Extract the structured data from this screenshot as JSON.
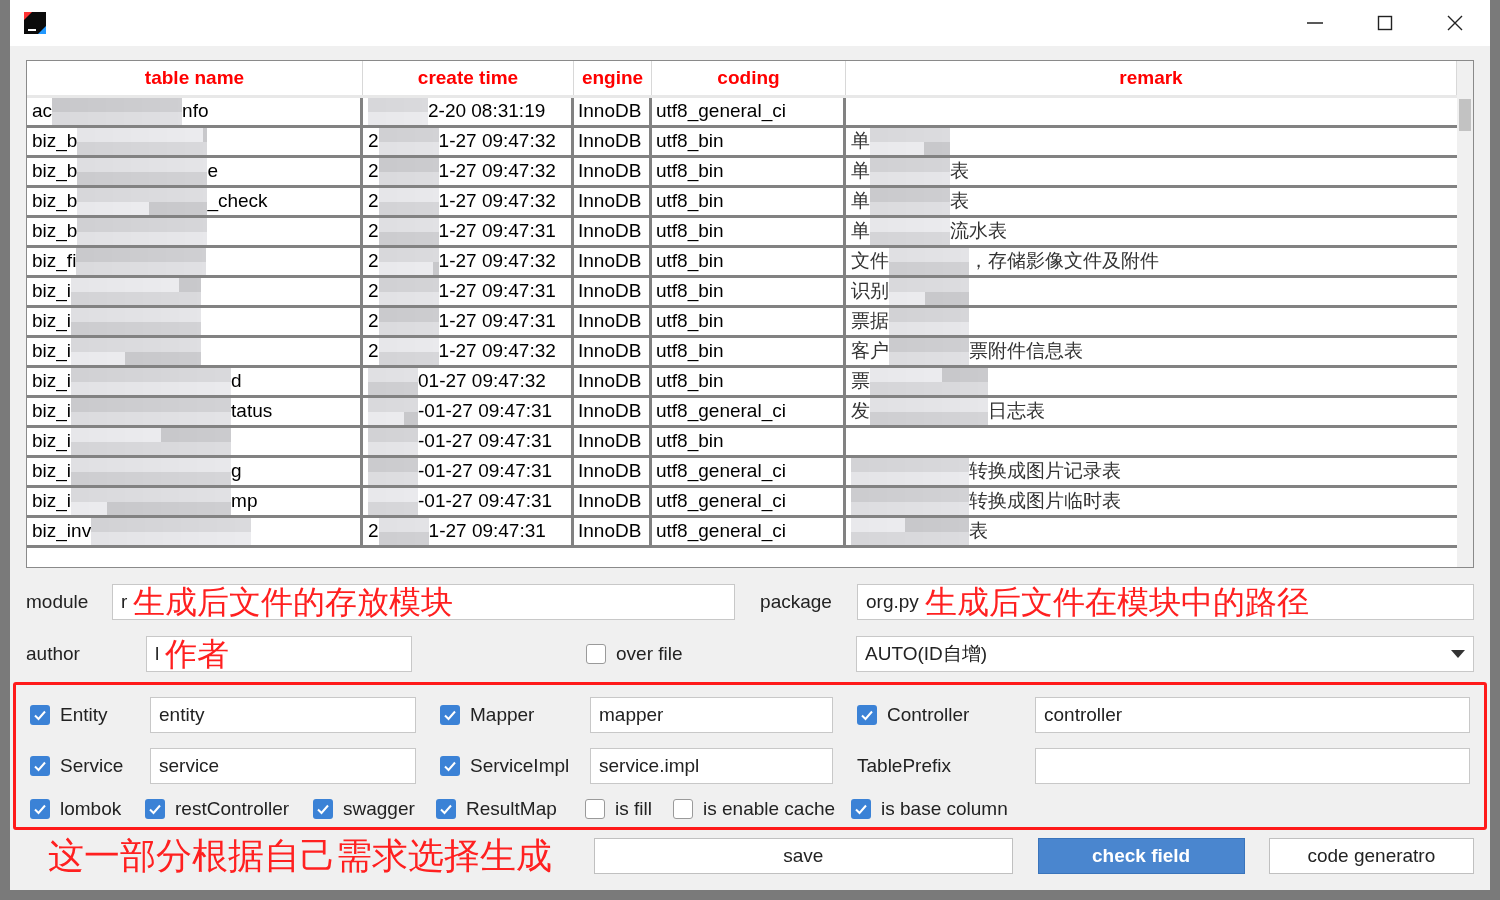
{
  "table": {
    "columns": [
      "table name",
      "create time",
      "engine",
      "coding",
      "remark"
    ],
    "rows": [
      {
        "name": {
          "start": "ac",
          "end": "nfo"
        },
        "time": {
          "end": "2-20 08:31:19"
        },
        "engine": "InnoDB",
        "coding": "utf8_general_ci",
        "remark": {}
      },
      {
        "name": {
          "start": "biz_b"
        },
        "time": {
          "start": "2",
          "end": "1-27 09:47:32"
        },
        "engine": "InnoDB",
        "coding": "utf8_bin",
        "remark": {
          "start": "单"
        }
      },
      {
        "name": {
          "start": "biz_b",
          "end": "e"
        },
        "time": {
          "start": "2",
          "end": "1-27 09:47:32"
        },
        "engine": "InnoDB",
        "coding": "utf8_bin",
        "remark": {
          "start": "单",
          "end": "表"
        }
      },
      {
        "name": {
          "start": "biz_b",
          "end": "_check"
        },
        "time": {
          "start": "2",
          "end": "1-27 09:47:32"
        },
        "engine": "InnoDB",
        "coding": "utf8_bin",
        "remark": {
          "start": "单",
          "end": "表"
        }
      },
      {
        "name": {
          "start": "biz_b"
        },
        "time": {
          "start": "2",
          "end": "1-27 09:47:31"
        },
        "engine": "InnoDB",
        "coding": "utf8_bin",
        "remark": {
          "start": "单",
          "end": "流水表"
        }
      },
      {
        "name": {
          "start": "biz_fi"
        },
        "time": {
          "start": "2",
          "end": "1-27 09:47:32"
        },
        "engine": "InnoDB",
        "coding": "utf8_bin",
        "remark": {
          "start": "文件",
          "end": "，存储影像文件及附件"
        }
      },
      {
        "name": {
          "start": "biz_i"
        },
        "time": {
          "start": "2",
          "end": "1-27 09:47:31"
        },
        "engine": "InnoDB",
        "coding": "utf8_bin",
        "remark": {
          "start": "识别"
        }
      },
      {
        "name": {
          "start": "biz_i"
        },
        "time": {
          "start": "2",
          "end": "1-27 09:47:31"
        },
        "engine": "InnoDB",
        "coding": "utf8_bin",
        "remark": {
          "start": "票据"
        }
      },
      {
        "name": {
          "start": "biz_i"
        },
        "time": {
          "start": "2",
          "end": "1-27 09:47:32"
        },
        "engine": "InnoDB",
        "coding": "utf8_bin",
        "remark": {
          "start": "客户",
          "end": "票附件信息表"
        }
      },
      {
        "name": {
          "start": "biz_i",
          "end": "d"
        },
        "time": {
          "end": "01-27 09:47:32"
        },
        "engine": "InnoDB",
        "coding": "utf8_bin",
        "remark": {
          "start": "票"
        }
      },
      {
        "name": {
          "start": "biz_i",
          "end": "tatus"
        },
        "time": {
          "end": "-01-27 09:47:31"
        },
        "engine": "InnoDB",
        "coding": "utf8_general_ci",
        "remark": {
          "start": "发",
          "end": "日志表"
        }
      },
      {
        "name": {
          "start": "biz_i"
        },
        "time": {
          "end": "-01-27 09:47:31"
        },
        "engine": "InnoDB",
        "coding": "utf8_bin",
        "remark": {}
      },
      {
        "name": {
          "start": "biz_i",
          "end": "g"
        },
        "time": {
          "end": "-01-27 09:47:31"
        },
        "engine": "InnoDB",
        "coding": "utf8_general_ci",
        "remark": {
          "end": "转换成图片记录表"
        }
      },
      {
        "name": {
          "start": "biz_i",
          "end": "mp"
        },
        "time": {
          "end": "-01-27 09:47:31"
        },
        "engine": "InnoDB",
        "coding": "utf8_general_ci",
        "remark": {
          "end": "转换成图片临时表"
        }
      },
      {
        "name": {
          "start": "biz_inv"
        },
        "time": {
          "start": "2",
          "end": "1-27 09:47:31"
        },
        "engine": "InnoDB",
        "coding": "utf8_general_ci",
        "remark": {
          "end": "表"
        }
      }
    ]
  },
  "module": {
    "label": "module",
    "value": "r",
    "note": "生成后文件的存放模块"
  },
  "package": {
    "label": "package",
    "value": "org.py",
    "note": "生成后文件在模块中的路径"
  },
  "author": {
    "label": "author",
    "value": "l",
    "note": "作者"
  },
  "over_file": {
    "label": "over file",
    "checked": false
  },
  "id_type": {
    "value": "AUTO(ID自增)"
  },
  "options_rows": [
    [
      {
        "kind": "checkbox",
        "label": "Entity",
        "checked": true
      },
      {
        "kind": "field",
        "value": "entity"
      },
      {
        "kind": "checkbox",
        "label": "Mapper",
        "checked": true
      },
      {
        "kind": "field",
        "value": "mapper"
      },
      {
        "kind": "checkbox",
        "label": "Controller",
        "checked": true
      },
      {
        "kind": "field",
        "value": "controller"
      }
    ],
    [
      {
        "kind": "checkbox",
        "label": "Service",
        "checked": true
      },
      {
        "kind": "field",
        "value": "service"
      },
      {
        "kind": "checkbox",
        "label": "ServiceImpl",
        "checked": true
      },
      {
        "kind": "field",
        "value": "service.impl"
      },
      {
        "kind": "label",
        "label": "TablePrefix"
      },
      {
        "kind": "field"
      }
    ]
  ],
  "flags": [
    {
      "label": "lombok",
      "checked": true
    },
    {
      "label": "restController",
      "checked": true
    },
    {
      "label": "swagger",
      "checked": true
    },
    {
      "label": "ResultMap",
      "checked": true
    },
    {
      "label": "is fill",
      "checked": false
    },
    {
      "label": "is enable cache",
      "checked": false
    },
    {
      "label": "is base column",
      "checked": true
    }
  ],
  "options_note": "这一部分根据自己需求选择生成",
  "buttons": [
    {
      "label": "save",
      "primary": false
    },
    {
      "label": "check field",
      "primary": true
    },
    {
      "label": "code generatro",
      "primary": false
    }
  ]
}
